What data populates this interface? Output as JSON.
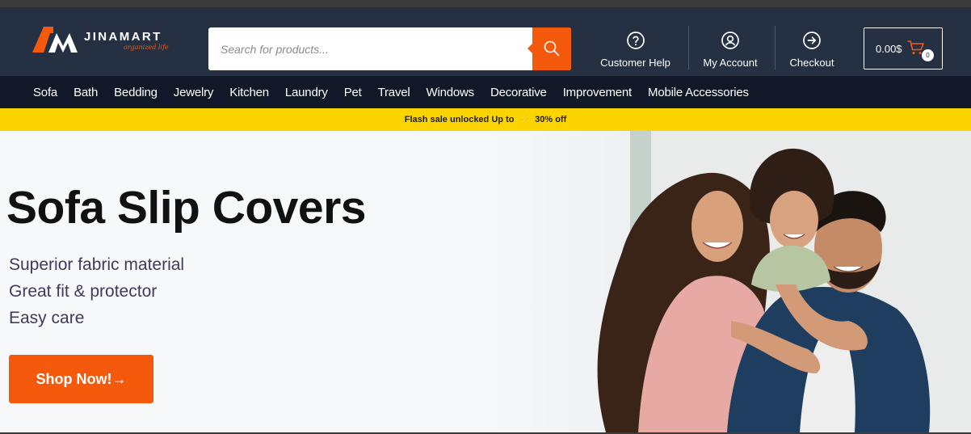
{
  "brand": {
    "name": "JINAMART",
    "tagline": "organized life",
    "accent": "#f55a0c"
  },
  "search": {
    "placeholder": "Search for products..."
  },
  "header_links": [
    {
      "label": "Customer Help",
      "icon": "question-circle-icon"
    },
    {
      "label": "My Account",
      "icon": "user-circle-icon"
    },
    {
      "label": "Checkout",
      "icon": "arrow-right-circle-icon"
    }
  ],
  "cart": {
    "amount": "0.00$",
    "count": "0"
  },
  "categories": [
    "Sofa",
    "Bath",
    "Bedding",
    "Jewelry",
    "Kitchen",
    "Laundry",
    "Pet",
    "Travel",
    "Windows",
    "Decorative",
    "Improvement",
    "Mobile Accessories"
  ],
  "flash": {
    "text": "Flash sale unlocked Up to",
    "discount": "30% off",
    "background": "#fcd400"
  },
  "hero": {
    "title": "Sofa Slip Covers",
    "features": [
      "Superior fabric material",
      "Great fit & protector",
      "Easy care"
    ],
    "cta": "Shop Now!→"
  },
  "colors": {
    "header_bg": "#253142",
    "nav_bg": "#111827",
    "hero_bg": "#f7f8fa"
  }
}
